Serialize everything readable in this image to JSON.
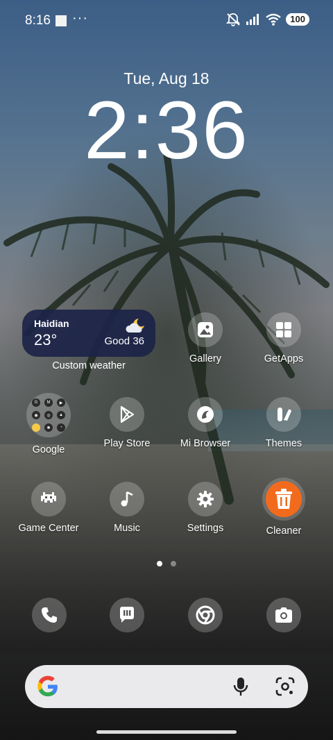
{
  "status_bar": {
    "time": "8:16",
    "battery": "100",
    "icons": [
      "notification-square-icon",
      "more-dots-icon",
      "mute-icon",
      "signal-icon",
      "wifi-icon",
      "battery-icon"
    ]
  },
  "lock": {
    "date": "Tue, Aug 18",
    "time": "2:36"
  },
  "weather_widget": {
    "city": "Haidian",
    "temperature": "23°",
    "air_quality": "Good 36",
    "icon": "partly-cloudy-night-icon",
    "label": "Custom weather"
  },
  "apps": {
    "gallery": "Gallery",
    "getapps": "GetApps",
    "google": "Google",
    "play_store": "Play Store",
    "mi_browser": "Mi Browser",
    "themes": "Themes",
    "game_center": "Game Center",
    "music": "Music",
    "settings": "Settings",
    "cleaner": "Cleaner"
  },
  "google_folder_items": [
    "G",
    "M",
    "▶",
    "◉",
    "◎",
    "▲",
    "✉",
    "◐",
    "●",
    "✱",
    "◔"
  ],
  "pager": {
    "pages": 2,
    "current": 1
  },
  "dock": [
    "phone-icon",
    "messages-icon",
    "chrome-icon",
    "camera-icon"
  ],
  "colors": {
    "weather_bg": "#1c2448",
    "cleaner_orange": "#f26b1d",
    "search_bg": "#f5f5f8"
  }
}
